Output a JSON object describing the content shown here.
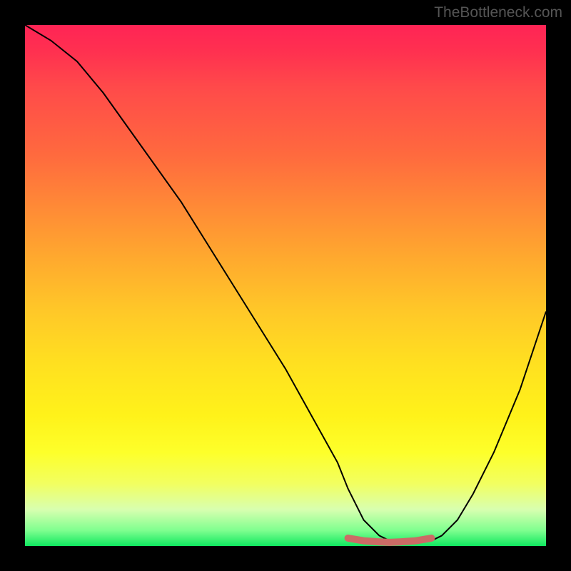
{
  "watermark": "TheBottleneck.com",
  "chart_data": {
    "type": "line",
    "title": "",
    "xlabel": "",
    "ylabel": "",
    "xlim": [
      0,
      100
    ],
    "ylim": [
      0,
      100
    ],
    "series": [
      {
        "name": "bottleneck-curve",
        "x": [
          0,
          5,
          10,
          15,
          20,
          25,
          30,
          35,
          40,
          45,
          50,
          55,
          60,
          62,
          65,
          68,
          70,
          72,
          75,
          78,
          80,
          83,
          86,
          90,
          95,
          100
        ],
        "values": [
          100,
          97,
          93,
          87,
          80,
          73,
          66,
          58,
          50,
          42,
          34,
          25,
          16,
          11,
          5,
          2,
          1,
          0.5,
          0.5,
          1,
          2,
          5,
          10,
          18,
          30,
          45
        ]
      },
      {
        "name": "min-marker",
        "x": [
          62,
          65,
          68,
          70,
          72,
          75,
          78
        ],
        "values": [
          1.5,
          1.0,
          0.8,
          0.7,
          0.8,
          1.0,
          1.5
        ]
      }
    ],
    "gradient_stops": [
      {
        "pos": 0,
        "color": "#ff2455"
      },
      {
        "pos": 25,
        "color": "#ff6a3e"
      },
      {
        "pos": 50,
        "color": "#ffba2a"
      },
      {
        "pos": 75,
        "color": "#fff21a"
      },
      {
        "pos": 95,
        "color": "#b8ffb0"
      },
      {
        "pos": 100,
        "color": "#10e860"
      }
    ]
  }
}
